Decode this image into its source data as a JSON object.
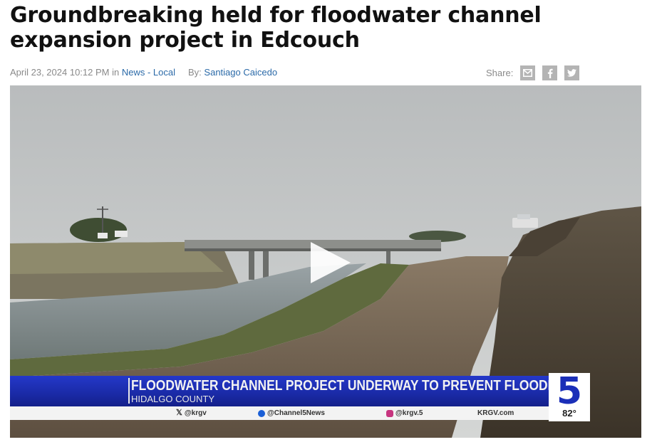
{
  "article": {
    "title": "Groundbreaking held for floodwater channel expansion project in Edcouch",
    "date": "April 23, 2024 10:12 PM",
    "in_label": "in",
    "category": "News - Local",
    "by_label": "By:",
    "author": "Santiago Caicedo"
  },
  "share": {
    "label": "Share:",
    "buttons": [
      "email-icon",
      "facebook-icon",
      "twitter-icon"
    ]
  },
  "video": {
    "play_icon": "play-icon",
    "lower_third": {
      "headline": "FLOODWATER CHANNEL PROJECT UNDERWAY TO PREVENT FLOODING",
      "location": "HIDALGO COUNTY",
      "station_number": "5",
      "temperature": "82°",
      "socials": {
        "x": "@krgv",
        "facebook": "@Channel5News",
        "instagram": "@krgv.5",
        "website": "KRGV.com"
      }
    }
  },
  "colors": {
    "link": "#2b6aa8",
    "meta_text": "#8a8a8a",
    "share_button": "#b4b4b4",
    "lower_third_blue": "#1a2aa6",
    "badge_blue": "#1b2fb8"
  }
}
